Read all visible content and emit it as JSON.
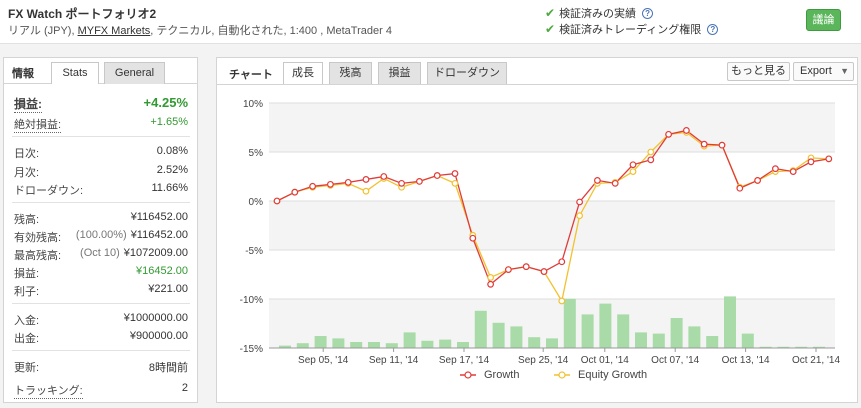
{
  "header": {
    "title": "FX Watch ポートフォリオ2",
    "subtitle_pre": "リアル (JPY), ",
    "broker_link": "MYFX Markets",
    "subtitle_post": ", テクニカル, 自動化された, 1:400 , MetaTrader 4",
    "verified_track_record": "検証済みの実績",
    "verified_trading_rights": "検証済みトレーディング権限",
    "discuss_button": "議論"
  },
  "left_panel": {
    "tab_info": "情報",
    "tab_stats": "Stats",
    "tab_general": "General",
    "gain_label": "損益:",
    "gain_value": "+4.25%",
    "abs_gain_label": "絶対損益:",
    "abs_gain_value": "+1.65%",
    "daily_label": "日次:",
    "daily_value": "0.08%",
    "monthly_label": "月次:",
    "monthly_value": "2.52%",
    "drawdown_label": "ドローダウン:",
    "drawdown_value": "11.66%",
    "balance_label": "残高:",
    "balance_value": "¥116452.00",
    "equity_label": "有効残高:",
    "equity_note": "(100.00%)",
    "equity_value": "¥116452.00",
    "highest_label": "最高残高:",
    "highest_note": "(Oct 10)",
    "highest_value": "¥1072009.00",
    "profit_label": "損益:",
    "profit_value": "¥16452.00",
    "interest_label": "利子:",
    "interest_value": "¥221.00",
    "deposits_label": "入金:",
    "deposits_value": "¥1000000.00",
    "withdrawals_label": "出金:",
    "withdrawals_value": "¥900000.00",
    "updated_label": "更新:",
    "updated_value": "8時間前",
    "tracking_label": "トラッキング:",
    "tracking_value": "2"
  },
  "chart_panel": {
    "tab_label": "チャート",
    "tabs": [
      "成長",
      "残高",
      "損益",
      "ドローダウン"
    ],
    "more_button": "もっと見る",
    "export_button": "Export"
  },
  "colors": {
    "growth": "#e03b3b",
    "equity": "#f2c12e",
    "bars": "#a8dba8",
    "green_text": "#339933"
  },
  "chart_data": {
    "type": "line",
    "title": "",
    "ylabel": "",
    "ylim": [
      -15,
      10
    ],
    "yticks": [
      "10%",
      "5%",
      "0%",
      "-5%",
      "-10%",
      "-15%"
    ],
    "xticks": [
      "Sep 05, '14",
      "Sep 11, '14",
      "Sep 17, '14",
      "Sep 25, '14",
      "Oct 01, '14",
      "Oct 07, '14",
      "Oct 13, '14",
      "Oct 21, '14"
    ],
    "grid": true,
    "legend_position": "bottom",
    "series": [
      {
        "name": "Growth",
        "values": [
          0.0,
          0.9,
          1.5,
          1.7,
          1.9,
          2.2,
          2.5,
          1.8,
          2.0,
          2.6,
          2.8,
          -3.8,
          -8.5,
          -7.0,
          -6.7,
          -7.2,
          -6.2,
          -0.1,
          2.1,
          1.8,
          3.7,
          4.2,
          6.8,
          7.2,
          5.8,
          5.7,
          1.3,
          2.1,
          3.3,
          3.0,
          4.0,
          4.3
        ]
      },
      {
        "name": "Equity Growth",
        "values": [
          0.0,
          0.9,
          1.4,
          1.6,
          1.8,
          1.0,
          2.3,
          1.4,
          2.0,
          2.6,
          1.8,
          -3.5,
          -7.8,
          -7.0,
          -6.7,
          -7.2,
          -10.2,
          -1.5,
          1.8,
          1.9,
          3.0,
          5.0,
          6.8,
          7.0,
          5.6,
          5.7,
          1.4,
          2.1,
          3.0,
          3.1,
          4.4,
          4.3
        ]
      }
    ],
    "bars": {
      "name": "",
      "values": [
        0.2,
        0.4,
        1.0,
        0.8,
        0.5,
        0.5,
        0.4,
        1.3,
        0.6,
        0.7,
        0.5,
        3.1,
        2.1,
        1.8,
        0.9,
        0.8,
        4.1,
        2.8,
        3.7,
        2.8,
        1.3,
        1.2,
        2.5,
        1.8,
        1.0,
        4.3,
        1.2,
        0.1,
        0.1,
        0.1,
        0.1
      ]
    }
  }
}
